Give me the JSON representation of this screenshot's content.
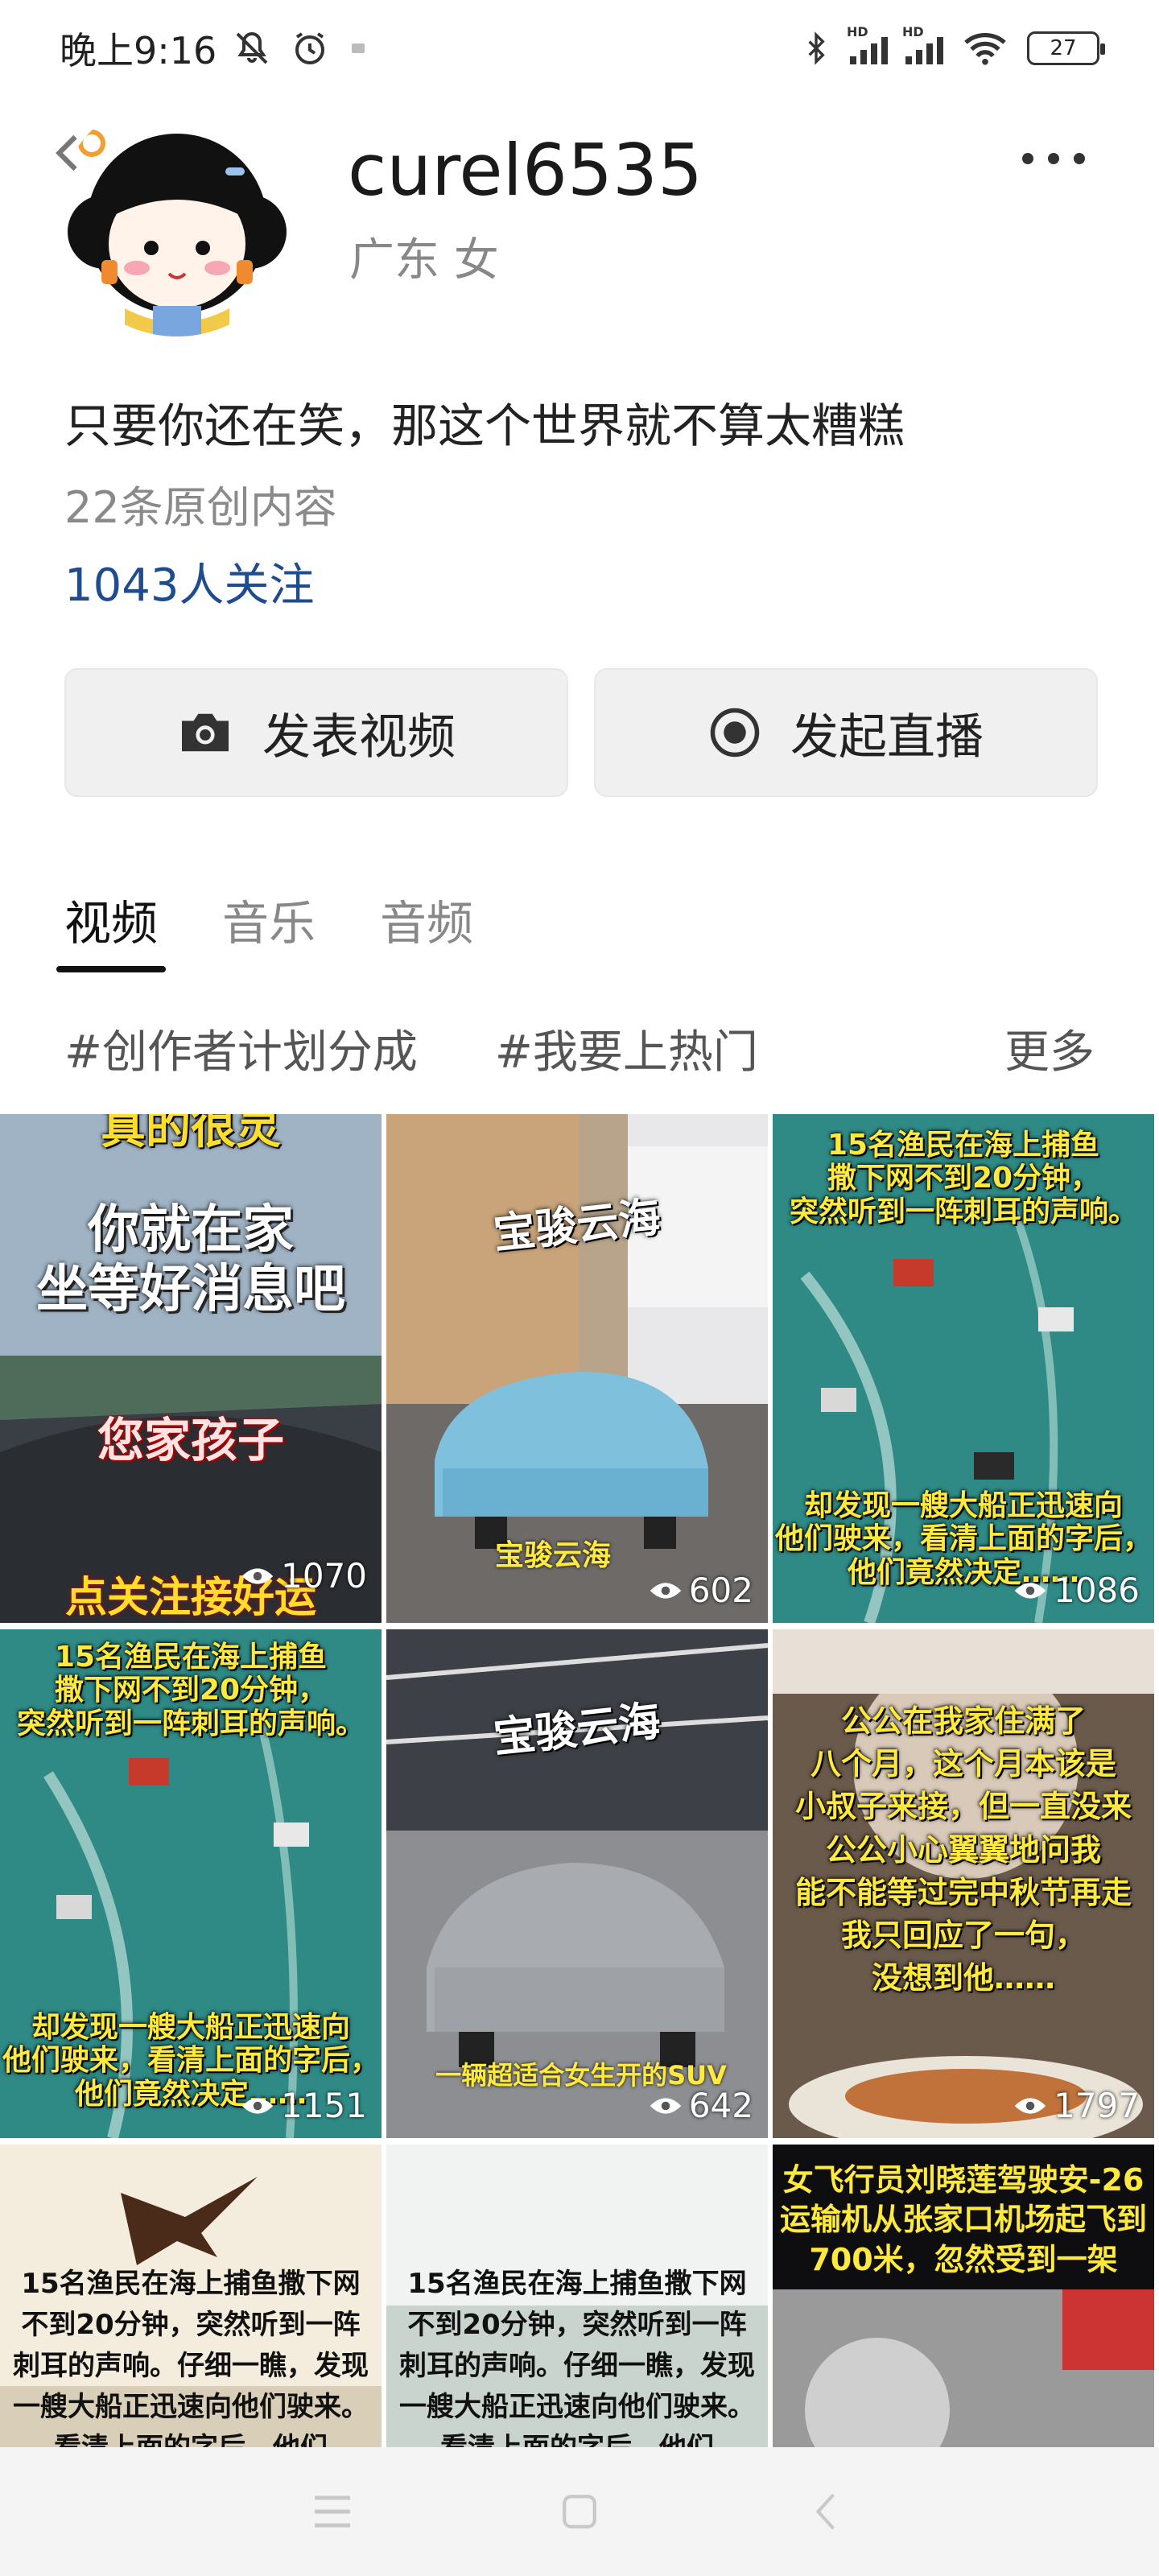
{
  "status_bar": {
    "time": "晚上9:16",
    "battery": "27",
    "signal_label_1": "HD",
    "signal_label_2": "HD"
  },
  "profile": {
    "username": "curel6535",
    "meta": "广东 女",
    "bio": "只要你还在笑，那这个世界就不算太糟糕",
    "works_count": "22条原创内容",
    "followers": "1043人关注"
  },
  "actions": {
    "post_video": "发表视频",
    "start_live": "发起直播"
  },
  "tabs": [
    "视频",
    "音乐",
    "音频"
  ],
  "topics": {
    "items": [
      "#创作者计划分成",
      "#我要上热门"
    ],
    "more": "更多"
  },
  "videos": [
    {
      "top": "真的很灵",
      "caption": "你就在家\n坐等好消息吧",
      "caption2": "您家孩子",
      "bottom": "点关注接好运",
      "views": "1070"
    },
    {
      "caption": "宝骏云海",
      "caption2": "宝骏云海",
      "views": "602"
    },
    {
      "caption": "15名渔民在海上捕鱼\n撒下网不到20分钟，\n突然听到一阵刺耳的声响。",
      "caption2": "却发现一艘大船正迅速向\n他们驶来，看清上面的字后，\n他们竟然决定……",
      "views": "1086"
    },
    {
      "caption": "15名渔民在海上捕鱼\n撒下网不到20分钟，\n突然听到一阵刺耳的声响。",
      "caption2": "却发现一艘大船正迅速向\n他们驶来，看清上面的字后，\n他们竟然决定……",
      "views": "1151"
    },
    {
      "caption": "宝骏云海",
      "caption2": "一辆超适合女生开的SUV",
      "views": "642"
    },
    {
      "caption": "公公在我家住满了\n八个月，这个月本该是\n小叔子来接，但一直没来\n公公小心翼翼地问我\n能不能等过完中秋节再走\n我只回应了一句，\n没想到他……",
      "views": "1797"
    },
    {
      "caption": "15名渔民在海上捕鱼撒下网\n不到20分钟，突然听到一阵\n刺耳的声响。仔细一瞧，发现\n一艘大船正迅速向他们驶来。\n看清上面的字后，他们"
    },
    {
      "caption": "15名渔民在海上捕鱼撒下网\n不到20分钟，突然听到一阵\n刺耳的声响。仔细一瞧，发现\n一艘大船正迅速向他们驶来。\n看清上面的字后，他们"
    },
    {
      "caption": "女飞行员刘晓莲驾驶安-26\n运输机从张家口机场起飞到\n700米，忽然受到一架"
    }
  ]
}
